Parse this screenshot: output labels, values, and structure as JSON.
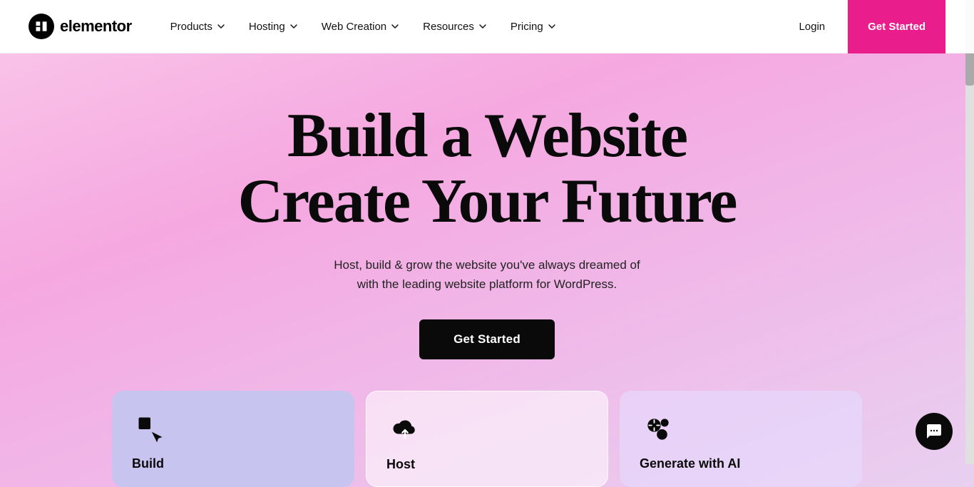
{
  "logo": {
    "text": "elementor"
  },
  "nav": {
    "items": [
      {
        "id": "products",
        "label": "Products",
        "has_dropdown": true
      },
      {
        "id": "hosting",
        "label": "Hosting",
        "has_dropdown": true
      },
      {
        "id": "web-creation",
        "label": "Web Creation",
        "has_dropdown": true
      },
      {
        "id": "resources",
        "label": "Resources",
        "has_dropdown": true
      },
      {
        "id": "pricing",
        "label": "Pricing",
        "has_dropdown": true
      }
    ],
    "login_label": "Login",
    "cta_label": "Get Started"
  },
  "hero": {
    "title_line1": "Build a Website",
    "title_line2": "Create Your Future",
    "subtitle": "Host, build & grow the website you've always dreamed of\nwith the leading website platform for WordPress.",
    "cta_label": "Get Started"
  },
  "cards": [
    {
      "id": "build",
      "label": "Build",
      "bg": "card-build"
    },
    {
      "id": "host",
      "label": "Host",
      "bg": "card-host"
    },
    {
      "id": "ai",
      "label": "Generate with AI",
      "bg": "card-ai"
    }
  ]
}
